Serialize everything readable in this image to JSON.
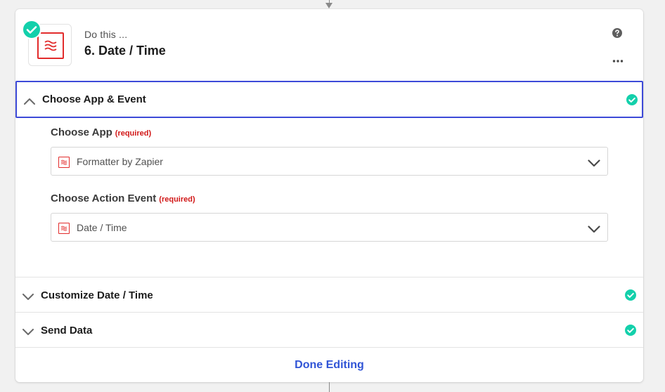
{
  "step": {
    "subtitle": "Do this ...",
    "title": "6. Date / Time",
    "icon": "formatter-logo-icon",
    "status": "complete"
  },
  "sections": [
    {
      "label": "Choose App & Event",
      "expanded": true,
      "complete": true
    },
    {
      "label": "Customize Date / Time",
      "expanded": false,
      "complete": true
    },
    {
      "label": "Send Data",
      "expanded": false,
      "complete": true
    }
  ],
  "fields": {
    "app": {
      "label": "Choose App",
      "required_text": "(required)",
      "value": "Formatter by Zapier"
    },
    "event": {
      "label": "Choose Action Event",
      "required_text": "(required)",
      "value": "Date / Time"
    }
  },
  "footer": {
    "done_label": "Done Editing"
  },
  "colors": {
    "accent_blue": "#3d4ad8",
    "link_blue": "#3054d6",
    "success_green": "#13d0ab",
    "required_red": "#d11717",
    "formatter_red": "#e22c2c"
  }
}
